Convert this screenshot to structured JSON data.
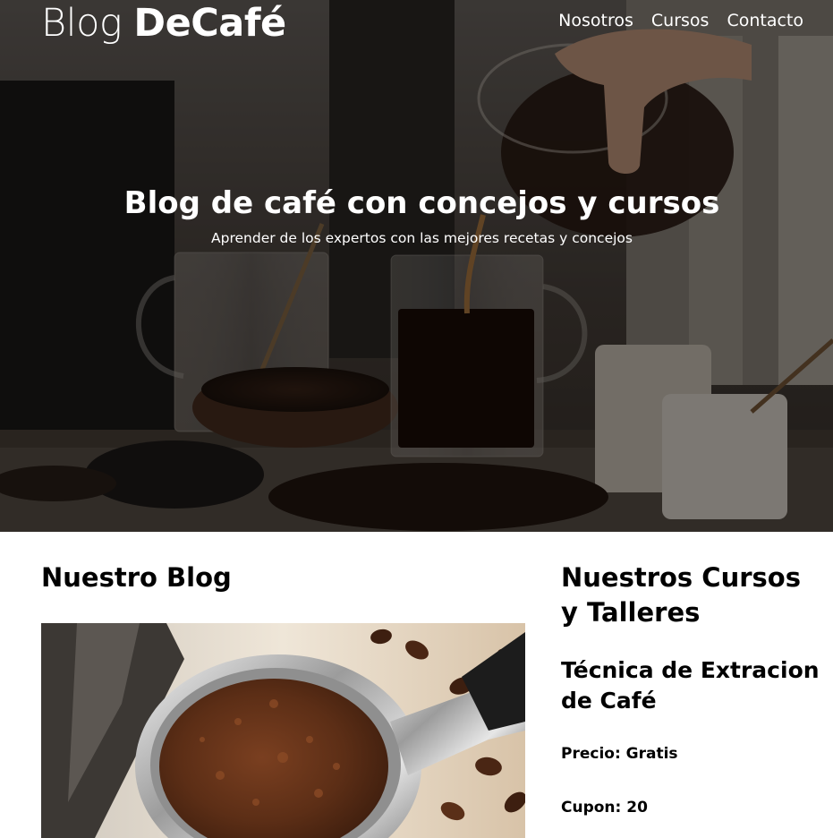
{
  "header": {
    "logo_light": "Blog ",
    "logo_bold": "DeCafé",
    "nav": [
      "Nosotros",
      "Cursos",
      "Contacto"
    ]
  },
  "hero": {
    "title": "Blog de café con concejos y cursos",
    "subtitle": "Aprender de los expertos con las mejores recetas y concejos",
    "image": "coffee-pouring-photo"
  },
  "blog": {
    "title": "Nuestro Blog",
    "image": "ground-coffee-portafilter-photo"
  },
  "courses": {
    "title": "Nuestros Cursos y Talleres",
    "items": [
      {
        "title": "Técnica de Extracion de Café",
        "price": "Precio: Gratis",
        "coupon": "Cupon: 20"
      }
    ]
  },
  "colors": {
    "hero_text": "#ffffff",
    "body_text": "#000000",
    "background": "#ffffff"
  }
}
